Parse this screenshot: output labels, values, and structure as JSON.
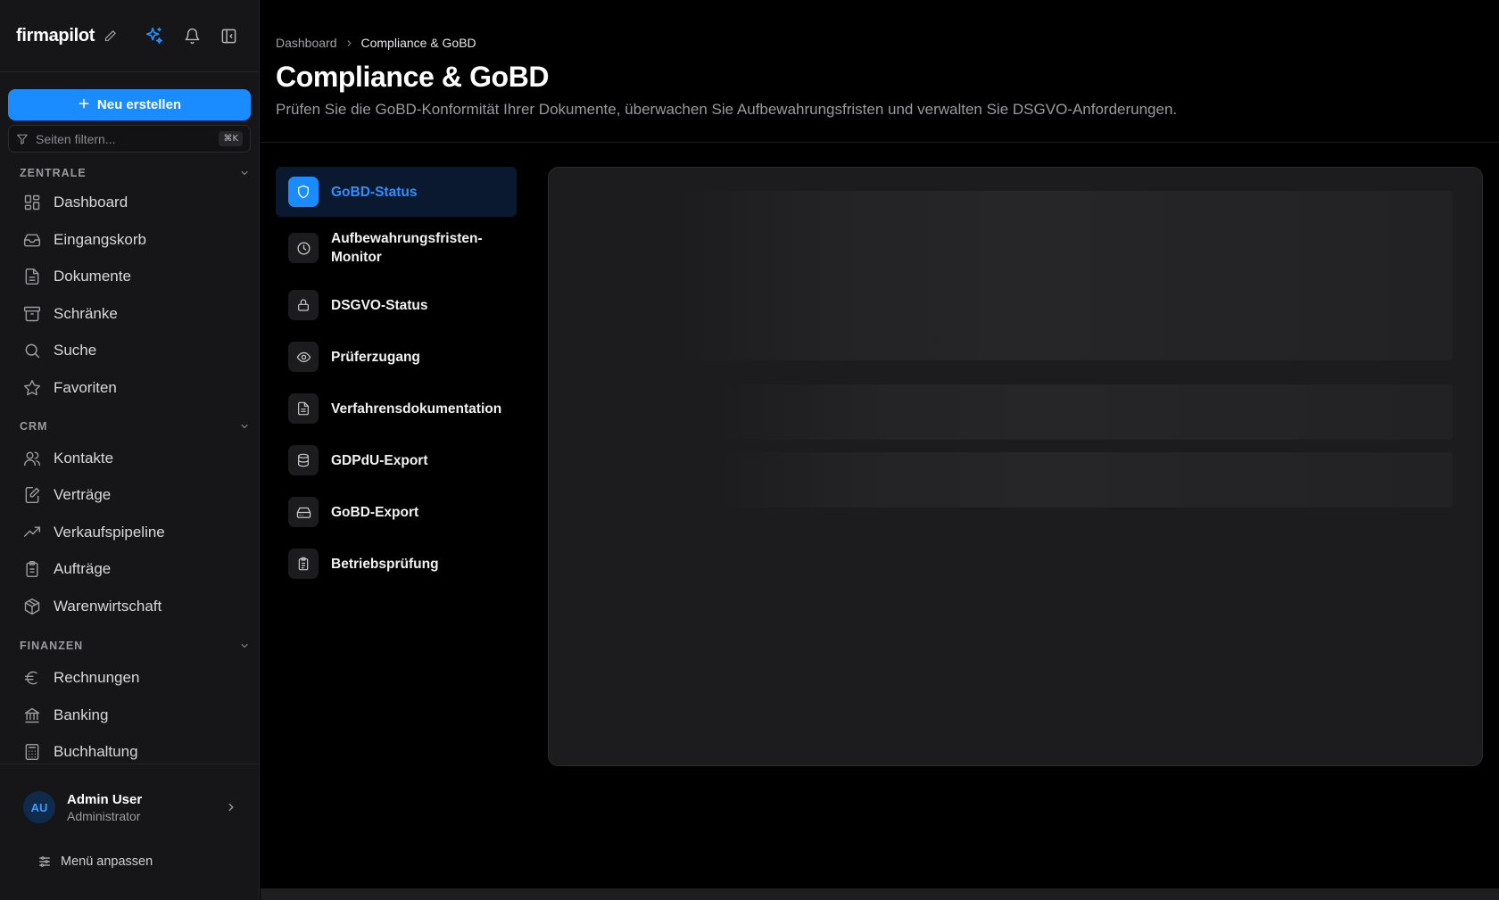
{
  "sidebar": {
    "brand": "firmapilot",
    "new_button": "Neu erstellen",
    "filter_placeholder": "Seiten filtern...",
    "filter_shortcut": "⌘K",
    "sections": [
      {
        "title": "ZENTRALE",
        "items": [
          {
            "label": "Dashboard",
            "icon": "dashboard-icon"
          },
          {
            "label": "Eingangskorb",
            "icon": "inbox-icon"
          },
          {
            "label": "Dokumente",
            "icon": "document-icon"
          },
          {
            "label": "Schränke",
            "icon": "archive-icon"
          },
          {
            "label": "Suche",
            "icon": "search-icon"
          },
          {
            "label": "Favoriten",
            "icon": "star-icon"
          }
        ]
      },
      {
        "title": "CRM",
        "items": [
          {
            "label": "Kontakte",
            "icon": "contacts-icon"
          },
          {
            "label": "Verträge",
            "icon": "contract-icon"
          },
          {
            "label": "Verkaufspipeline",
            "icon": "trend-icon"
          },
          {
            "label": "Aufträge",
            "icon": "clipboard-icon"
          },
          {
            "label": "Warenwirtschaft",
            "icon": "package-icon"
          }
        ]
      },
      {
        "title": "FINANZEN",
        "items": [
          {
            "label": "Rechnungen",
            "icon": "euro-icon"
          },
          {
            "label": "Banking",
            "icon": "bank-icon"
          },
          {
            "label": "Buchhaltung",
            "icon": "calculator-icon"
          }
        ]
      }
    ],
    "user": {
      "initials": "AU",
      "name": "Admin User",
      "role": "Administrator"
    },
    "customize_label": "Menü anpassen"
  },
  "breadcrumb": {
    "root": "Dashboard",
    "current": "Compliance & GoBD"
  },
  "page": {
    "title": "Compliance & GoBD",
    "description": "Prüfen Sie die GoBD-Konformität Ihrer Dokumente, überwachen Sie Aufbewahrungsfristen und verwalten Sie DSGVO-Anforderungen."
  },
  "sub_nav": [
    {
      "label": "GoBD-Status",
      "icon": "shield-icon",
      "active": true
    },
    {
      "label": "Aufbewahrungsfristen-\nMonitor",
      "icon": "clock-icon",
      "active": false
    },
    {
      "label": "DSGVO-Status",
      "icon": "lock-icon",
      "active": false
    },
    {
      "label": "Prüferzugang",
      "icon": "eye-icon",
      "active": false
    },
    {
      "label": "Verfahrensdokumentation",
      "icon": "file-text-icon",
      "active": false
    },
    {
      "label": "GDPdU-Export",
      "icon": "database-icon",
      "active": false
    },
    {
      "label": "GoBD-Export",
      "icon": "drive-icon",
      "active": false
    },
    {
      "label": "Betriebsprüfung",
      "icon": "clipboard-list-icon",
      "active": false
    }
  ],
  "colors": {
    "accent": "#1a8cff",
    "background": "#000000",
    "sidebar": "#161618"
  }
}
